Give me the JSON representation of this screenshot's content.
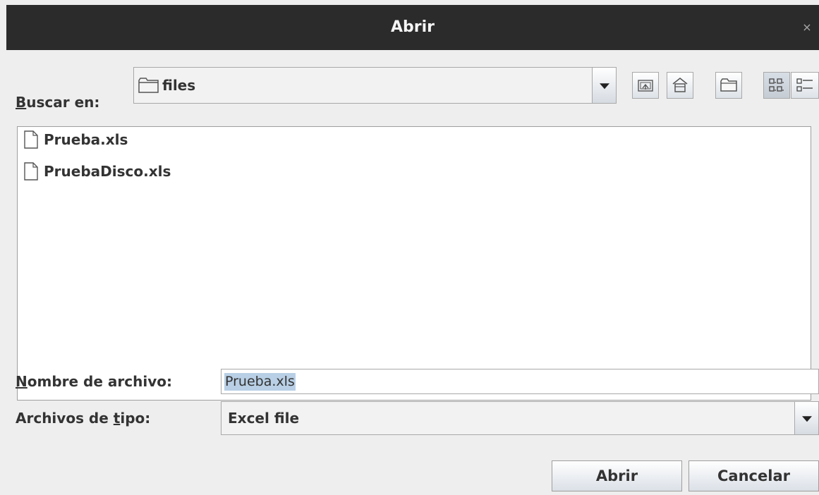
{
  "window": {
    "title": "Abrir",
    "close_glyph": "×"
  },
  "look_in": {
    "label": "Buscar en:",
    "label_mnemonic": "B",
    "label_rest": "uscar en:",
    "folder_icon": "folder-icon",
    "value": "files"
  },
  "toolbar": {
    "buttons": [
      {
        "name": "up-one-level-button",
        "icon": "up-folder-icon"
      },
      {
        "name": "home-button",
        "icon": "home-icon"
      },
      {
        "name": "new-folder-button",
        "icon": "new-folder-icon"
      },
      {
        "name": "list-view-button",
        "icon": "list-view-icon",
        "pressed": true
      },
      {
        "name": "details-view-button",
        "icon": "details-view-icon"
      }
    ]
  },
  "files": [
    {
      "name": "Prueba.xls",
      "icon": "file-icon"
    },
    {
      "name": "PruebaDisco.xls",
      "icon": "file-icon"
    }
  ],
  "file_name": {
    "label_mnemonic": "N",
    "label_rest": "ombre de archivo:",
    "value": "Prueba.xls"
  },
  "file_type": {
    "label_before": "Archivos de ",
    "label_mnemonic": "t",
    "label_after": "ipo:",
    "value": "Excel file"
  },
  "actions": {
    "open_label": "Abrir",
    "cancel_label": "Cancelar"
  }
}
